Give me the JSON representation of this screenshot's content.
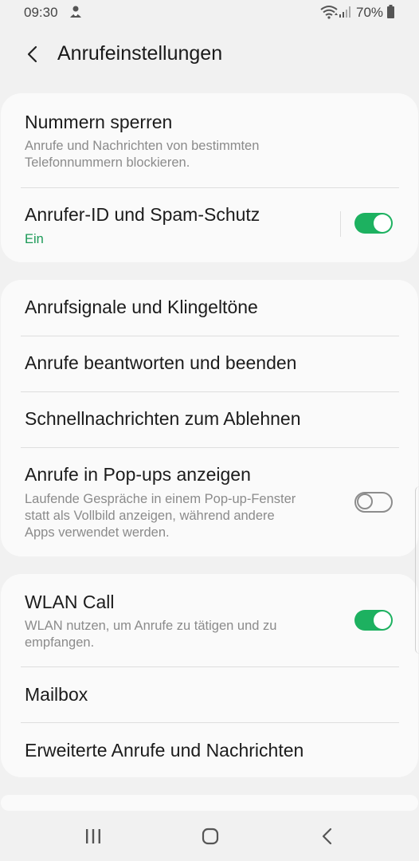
{
  "status_bar": {
    "time": "09:30",
    "battery": "70%",
    "notification_icon": "person-icon",
    "wifi_icon": "wifi-icon",
    "signal_icon": "signal-icon",
    "battery_icon": "battery-icon"
  },
  "header": {
    "title": "Anrufeinstellungen",
    "back_icon": "back-arrow-icon"
  },
  "group1": {
    "block_numbers": {
      "title": "Nummern sperren",
      "subtitle_line1": "Anrufe und Nachrichten von bestimmten",
      "subtitle_line2": "Telefonnummern blockieren."
    },
    "caller_id": {
      "title": "Anrufer-ID und Spam-Schutz",
      "status": "Ein",
      "toggle": true
    }
  },
  "group2": {
    "ringtones": {
      "title": "Anrufsignale und Klingeltöne"
    },
    "answer_end": {
      "title": "Anrufe beantworten und beenden"
    },
    "quick_decline": {
      "title": "Schnellnachrichten zum Ablehnen"
    },
    "popups": {
      "title": "Anrufe in Pop-ups anzeigen",
      "subtitle_line1": "Laufende Gespräche in einem Pop-up-Fenster",
      "subtitle_line2": "statt als Vollbild anzeigen, während andere",
      "subtitle_line3": "Apps verwendet werden.",
      "toggle": false
    }
  },
  "group3": {
    "wlan_call": {
      "title": "WLAN Call",
      "subtitle_line1": "WLAN nutzen, um Anrufe zu tätigen und zu",
      "subtitle_line2": "empfangen.",
      "toggle": true
    },
    "mailbox": {
      "title": "Mailbox"
    },
    "advanced": {
      "title": "Erweiterte Anrufe und Nachrichten"
    }
  },
  "colors": {
    "accent_green": "#1db160",
    "status_green": "#1b9a57",
    "background": "#f1f1f1",
    "card": "#fafafa"
  },
  "navbar": {
    "recents_icon": "recents-icon",
    "home_icon": "home-icon",
    "back_icon": "back-icon"
  }
}
